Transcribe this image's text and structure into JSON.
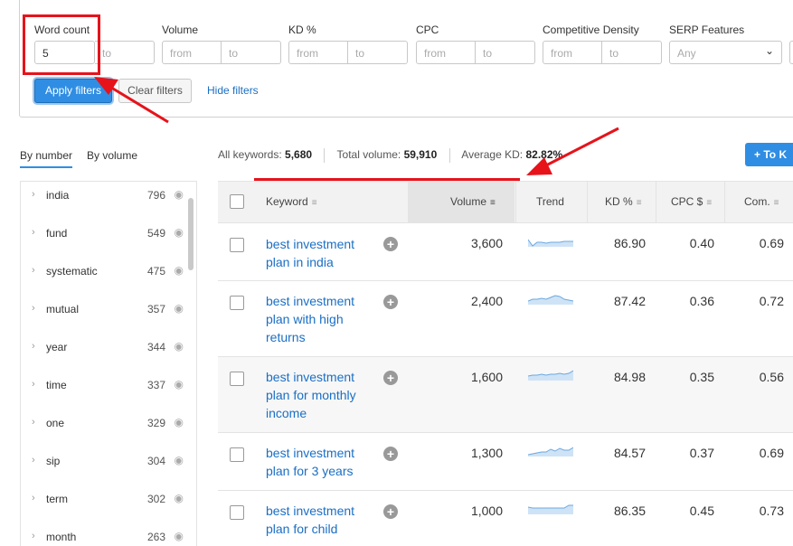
{
  "filters": {
    "word_count": {
      "label": "Word count",
      "from_value": "5",
      "to_placeholder": "to"
    },
    "volume": {
      "label": "Volume",
      "from_placeholder": "from",
      "to_placeholder": "to"
    },
    "kd": {
      "label": "KD %",
      "from_placeholder": "from",
      "to_placeholder": "to"
    },
    "cpc": {
      "label": "CPC",
      "from_placeholder": "from",
      "to_placeholder": "to"
    },
    "competitive_density": {
      "label": "Competitive Density",
      "from_placeholder": "from",
      "to_placeholder": "to"
    },
    "serp_features": {
      "label": "SERP Features",
      "value": "Any"
    },
    "apply_label": "Apply filters",
    "clear_label": "Clear filters",
    "hide_label": "Hide filters"
  },
  "tabs": [
    {
      "label": "By number",
      "active": true
    },
    {
      "label": "By volume",
      "active": false
    }
  ],
  "summary": {
    "all_keywords_label": "All keywords:",
    "all_keywords_value": "5,680",
    "total_volume_label": "Total volume:",
    "total_volume_value": "59,910",
    "avg_kd_label": "Average KD:",
    "avg_kd_value": "82.82%",
    "to_button_label": "+ To K"
  },
  "sidebar": {
    "items": [
      {
        "label": "india",
        "count": "796"
      },
      {
        "label": "fund",
        "count": "549"
      },
      {
        "label": "systematic",
        "count": "475"
      },
      {
        "label": "mutual",
        "count": "357"
      },
      {
        "label": "year",
        "count": "344"
      },
      {
        "label": "time",
        "count": "337"
      },
      {
        "label": "one",
        "count": "329"
      },
      {
        "label": "sip",
        "count": "304"
      },
      {
        "label": "term",
        "count": "302"
      },
      {
        "label": "month",
        "count": "263"
      }
    ]
  },
  "table": {
    "headers": {
      "keyword": "Keyword",
      "volume": "Volume",
      "trend": "Trend",
      "kd": "KD %",
      "cpc": "CPC $",
      "com": "Com."
    },
    "rows": [
      {
        "keyword": "best investment plan in india",
        "volume": "3,600",
        "kd": "86.90",
        "cpc": "0.40",
        "com": "0.69"
      },
      {
        "keyword": "best investment plan with high returns",
        "volume": "2,400",
        "kd": "87.42",
        "cpc": "0.36",
        "com": "0.72"
      },
      {
        "keyword": "best investment plan for monthly income",
        "volume": "1,600",
        "kd": "84.98",
        "cpc": "0.35",
        "com": "0.56"
      },
      {
        "keyword": "best investment plan for 3 years",
        "volume": "1,300",
        "kd": "84.57",
        "cpc": "0.37",
        "com": "0.69"
      },
      {
        "keyword": "best investment plan for child",
        "volume": "1,000",
        "kd": "86.35",
        "cpc": "0.45",
        "com": "0.73"
      }
    ]
  },
  "colors": {
    "accent": "#2f8ee3",
    "link": "#1a6fc5",
    "highlight": "#e6131b"
  }
}
